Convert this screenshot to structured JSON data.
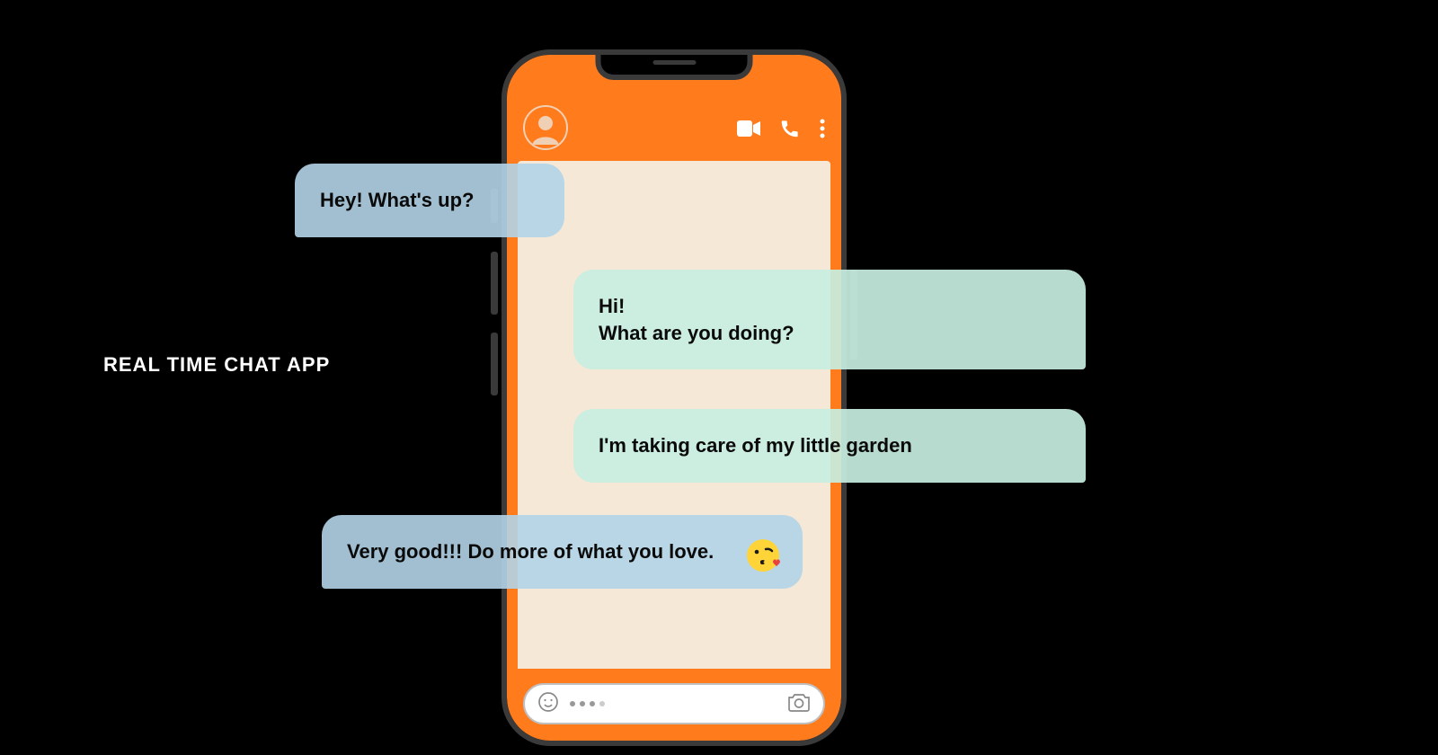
{
  "title": "REAL TIME CHAT APP",
  "colors": {
    "background": "#000000",
    "accent": "#ff7b1c",
    "chat_body": "#f6e8d6",
    "bubble_in": "#b2d4e8",
    "bubble_out": "#c8eee1"
  },
  "header": {
    "avatar": {
      "icon": "user-silhouette-icon"
    },
    "actions": [
      {
        "icon": "video-icon"
      },
      {
        "icon": "phone-icon"
      },
      {
        "icon": "more-vertical-icon"
      }
    ]
  },
  "input": {
    "emoji_icon": "smile-icon",
    "camera_icon": "camera-icon",
    "placeholder_dots": 4
  },
  "messages": [
    {
      "direction": "incoming",
      "text": "Hey! What's up?"
    },
    {
      "direction": "outgoing",
      "text": "Hi!\nWhat are you doing?"
    },
    {
      "direction": "outgoing",
      "text": "I'm taking care of my little garden"
    },
    {
      "direction": "incoming",
      "text": "Very good!!! Do more of what you love.",
      "emoji": "face-blowing-kiss"
    }
  ]
}
